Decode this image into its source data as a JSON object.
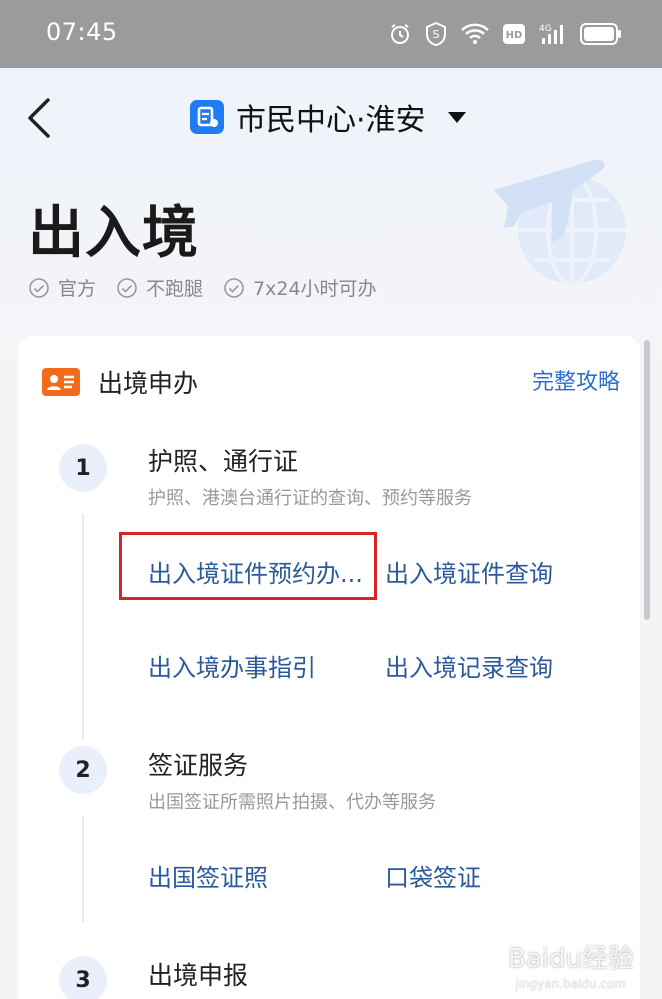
{
  "status_bar": {
    "time": "07:45",
    "icons": [
      "alarm-icon",
      "shield-icon",
      "wifi-icon",
      "hd-icon",
      "4g-signal-icon",
      "battery-icon"
    ]
  },
  "header": {
    "back_icon": "back-chevron-icon",
    "app_title": "市民中心·淮安",
    "dropdown_icon": "caret-down-icon"
  },
  "page": {
    "title": "出入境",
    "features": [
      "官方",
      "不跑腿",
      "7x24小时可办"
    ]
  },
  "card": {
    "title": "出境申办",
    "link": "完整攻略",
    "steps": [
      {
        "number": "1",
        "title": "护照、通行证",
        "desc": "护照、港澳台通行证的查询、预约等服务",
        "services": [
          "出入境证件预约办...",
          "出入境证件查询",
          "出入境办事指引",
          "出入境记录查询"
        ]
      },
      {
        "number": "2",
        "title": "签证服务",
        "desc": "出国签证所需照片拍摄、代办等服务",
        "services": [
          "出国签证照",
          "口袋签证"
        ]
      },
      {
        "number": "3",
        "title": "出境申报",
        "desc": "",
        "services": []
      }
    ]
  },
  "watermark": {
    "text": "Baidu经验",
    "sub": "jingyan.baidu.com"
  },
  "colors": {
    "accent": "#2e6fd1",
    "service_link": "#2b5a9b",
    "card_icon": "#f26b1d",
    "highlight": "#d82627",
    "logo": "#1f7cf2"
  }
}
